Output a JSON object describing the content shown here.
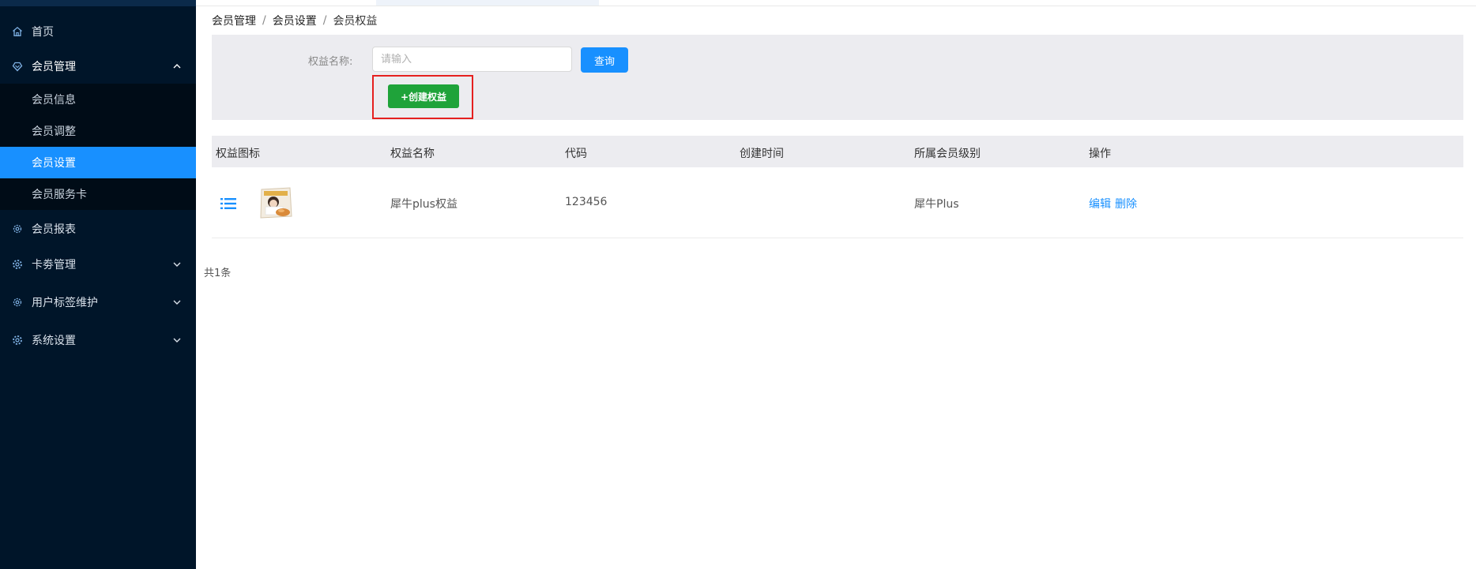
{
  "sidebar": {
    "items": [
      {
        "label": "首页",
        "icon": "home-icon"
      },
      {
        "label": "会员管理",
        "icon": "heart-shield-icon",
        "expanded": true
      },
      {
        "label": "会员报表",
        "icon": "gear-icon"
      },
      {
        "label": "卡劵管理",
        "icon": "cog-icon"
      },
      {
        "label": "用户标签维护",
        "icon": "gear-icon"
      },
      {
        "label": "系统设置",
        "icon": "cog-icon"
      }
    ],
    "submenu": [
      {
        "label": "会员信息"
      },
      {
        "label": "会员调整"
      },
      {
        "label": "会员设置",
        "active": true
      },
      {
        "label": "会员服务卡"
      }
    ]
  },
  "breadcrumb": {
    "items": [
      "会员管理",
      "会员设置",
      "会员权益"
    ],
    "separator": "/"
  },
  "filter": {
    "label": "权益名称:",
    "placeholder": "请输入",
    "value": "",
    "query_label": "查询",
    "create_label": "+创建权益"
  },
  "table": {
    "headers": [
      "权益图标",
      "权益名称",
      "代码",
      "创建时间",
      "所属会员级别",
      "操作"
    ],
    "rows": [
      {
        "name": "犀牛plus权益",
        "code": "123456",
        "created": "",
        "level": "犀牛Plus",
        "edit_label": "编辑",
        "delete_label": "删除"
      }
    ]
  },
  "pagination": {
    "total_text": "共1条"
  },
  "colors": {
    "sidebar_bg": "#001529",
    "accent": "#1890ff",
    "create_button": "#1fa33a",
    "highlight": "#e5201f"
  }
}
